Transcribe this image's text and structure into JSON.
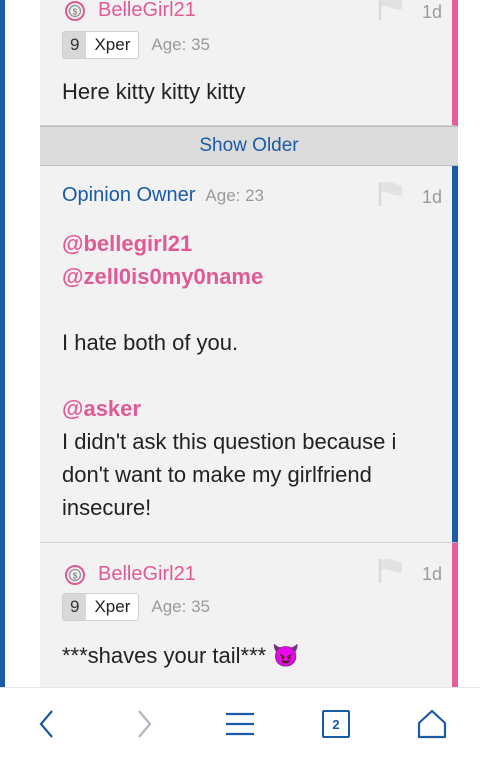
{
  "comments": [
    {
      "username": "BelleGirl21",
      "badge_level": "9",
      "badge_label": "Xper",
      "age": "Age: 35",
      "time": "1d",
      "text": "Here kitty kitty kitty"
    },
    {
      "username": "Opinion Owner",
      "age": "Age: 23",
      "time": "1d",
      "mention1": "@bellegirl21",
      "mention2": "@zell0is0my0name",
      "line1": "I hate both of you.",
      "mention3": "@asker",
      "line2": "I didn't ask this question because i don't want to make my girlfriend insecure!"
    },
    {
      "username": "BelleGirl21",
      "badge_level": "9",
      "badge_label": "Xper",
      "age": "Age: 35",
      "time": "1d",
      "text": "***shaves your tail*** 😈"
    }
  ],
  "show_older_label": "Show Older",
  "nav": {
    "tab_count": "2"
  },
  "colors": {
    "accent_blue": "#1a5aa6",
    "accent_pink": "#e45f9b"
  }
}
